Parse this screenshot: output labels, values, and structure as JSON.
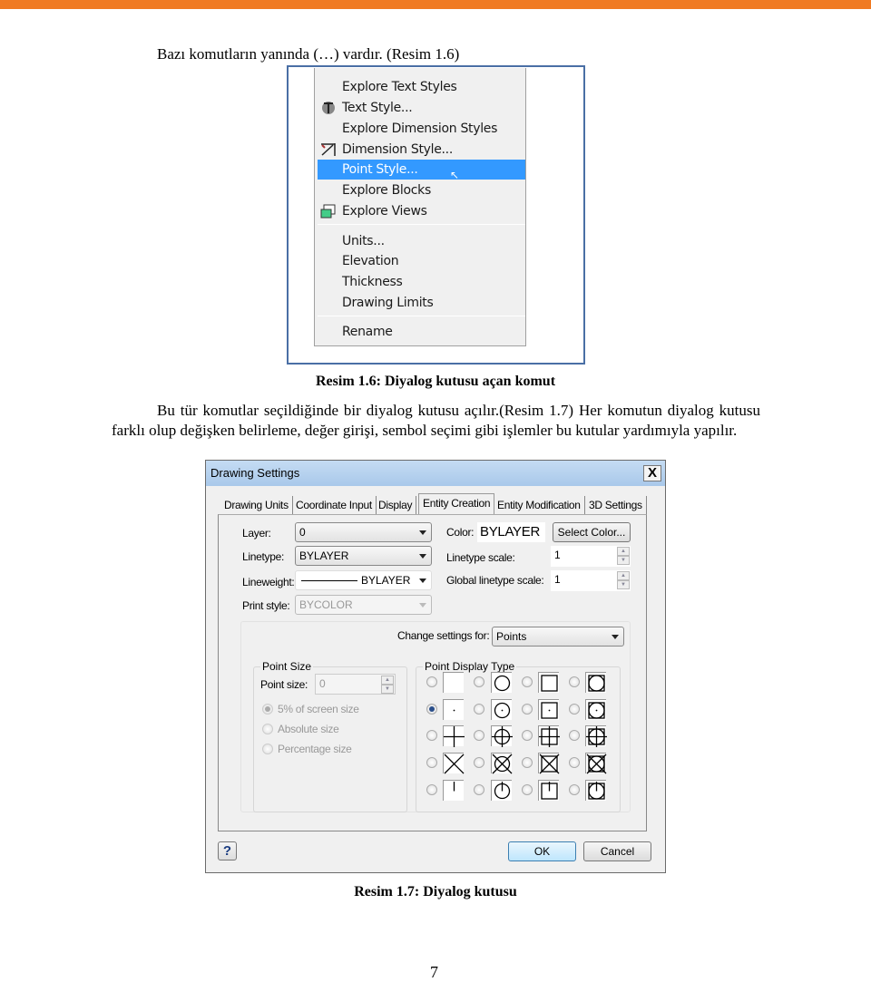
{
  "colors": {
    "accent_bar": "#f07a22",
    "menu_highlight": "#3399ff"
  },
  "intro": "Bazı komutların yanında (…) vardır. (Resim 1.6)",
  "menu": {
    "items": [
      {
        "label": "Explore Text Styles",
        "icon": ""
      },
      {
        "label": "Text Style...",
        "icon": "text-style-icon"
      },
      {
        "label": "Explore Dimension Styles",
        "icon": ""
      },
      {
        "label": "Dimension Style...",
        "icon": "dimension-style-icon"
      },
      {
        "label": "Point Style...",
        "icon": "",
        "highlighted": true
      },
      {
        "label": "Explore Blocks",
        "icon": ""
      },
      {
        "label": "Explore Views",
        "icon": "explore-views-icon"
      },
      {
        "label": "Units...",
        "icon": ""
      },
      {
        "label": "Elevation",
        "icon": ""
      },
      {
        "label": "Thickness",
        "icon": ""
      },
      {
        "label": "Drawing Limits",
        "icon": ""
      },
      {
        "label": "Rename",
        "icon": ""
      }
    ]
  },
  "caption1": "Resim 1.6: Diyalog kutusu açan komut",
  "paragraph": "Bu tür komutlar seçildiğinde bir diyalog kutusu açılır.(Resim 1.7) Her komutun diyalog kutusu farklı olup değişken belirleme, değer girişi, sembol seçimi gibi işlemler bu kutular yardımıyla yapılır.",
  "dialog": {
    "title": "Drawing Settings",
    "close": "X",
    "tabs": [
      "Drawing Units",
      "Coordinate Input",
      "Display",
      "Entity Creation",
      "Entity Modification",
      "3D Settings"
    ],
    "active_tab": "Entity Creation",
    "layer_label": "Layer:",
    "layer_value": "0",
    "linetype_label": "Linetype:",
    "linetype_value": "BYLAYER",
    "lineweight_label": "Lineweight:",
    "lineweight_value": "BYLAYER",
    "printstyle_label": "Print style:",
    "printstyle_value": "BYCOLOR",
    "color_label": "Color:",
    "color_value": "BYLAYER",
    "select_color": "Select Color...",
    "ltscale_label": "Linetype scale:",
    "ltscale_value": "1",
    "gltscale_label": "Global linetype scale:",
    "gltscale_value": "1",
    "change_label": "Change settings for:",
    "change_value": "Points",
    "point_size_group": "Point Size",
    "point_size_label": "Point size:",
    "point_size_value": "0",
    "size_options": [
      {
        "label": "5% of screen size",
        "selected": true
      },
      {
        "label": "Absolute size"
      },
      {
        "label": "Percentage size"
      }
    ],
    "display_type_group": "Point Display Type",
    "display_types": {
      "marks": [
        "none",
        "dot",
        "plus",
        "cross",
        "tick"
      ],
      "bases": [
        "plain",
        "circle",
        "square",
        "circle-square"
      ],
      "selected": {
        "mark": "dot",
        "base": "plain"
      }
    },
    "help": "?",
    "ok": "OK",
    "cancel": "Cancel"
  },
  "caption2": "Resim 1.7: Diyalog kutusu",
  "page_number": "7"
}
